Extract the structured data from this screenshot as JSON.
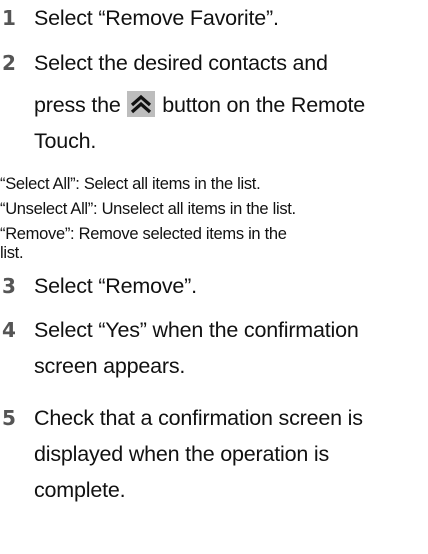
{
  "steps": [
    {
      "number": "1",
      "text": "Select “Remove Favorite”."
    },
    {
      "number": "2",
      "text_line1": "Select the desired contacts and",
      "text_line2_before": "press the",
      "text_line2_after": "button on the Remote",
      "text_line3": "Touch.",
      "icon": "chevron-up-double-icon"
    },
    {
      "number": "3",
      "text": "Select “Remove”."
    },
    {
      "number": "4",
      "text_line1": "Select “Yes” when the confirmation",
      "text_line2": "screen appears."
    },
    {
      "number": "5",
      "text_line1": "Check that a confirmation screen is",
      "text_line2": "displayed when the operation is",
      "text_line3": "complete."
    }
  ],
  "notes": [
    "“Select All”: Select all items in the list.",
    "“Unselect All”: Unselect all items in the list.",
    "“Remove”: Remove selected items in the",
    "list."
  ],
  "colors": {
    "text": "#111111",
    "step_number": "#555555",
    "button_bg": "#bdbdbd",
    "button_icon": "#111111"
  }
}
